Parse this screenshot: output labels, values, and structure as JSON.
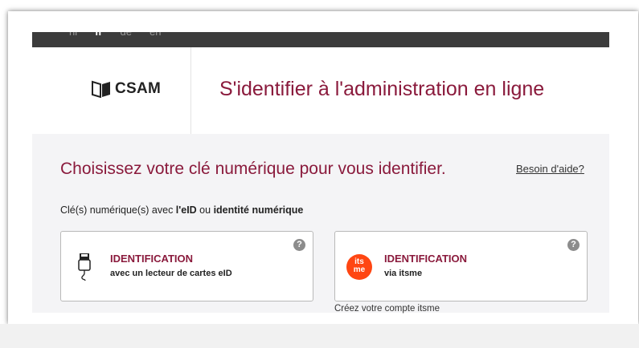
{
  "languages": [
    {
      "label": "nl",
      "active": false
    },
    {
      "label": "fr",
      "active": true
    },
    {
      "label": "de",
      "active": false
    },
    {
      "label": "en",
      "active": false
    }
  ],
  "header": {
    "logo_text": "CSAM",
    "title": "S'identifier à l'administration en ligne"
  },
  "main": {
    "choose_title": "Choisissez votre clé numérique pour vous identifier.",
    "help_link": "Besoin d'aide?",
    "subtitle": {
      "prefix": "Clé(s) numérique(s) avec ",
      "bold1": "l'eID",
      "middle": " ou ",
      "bold2": "identité numérique"
    },
    "cards": [
      {
        "title": "IDENTIFICATION",
        "subtitle": "avec un lecteur de cartes eID",
        "icon": "card-reader-icon"
      },
      {
        "title": "IDENTIFICATION",
        "subtitle": "via itsme",
        "icon": "itsme-logo-icon",
        "icon_text_line1": "its",
        "icon_text_line2": "me"
      }
    ],
    "create_link": "Créez votre compte itsme"
  },
  "colors": {
    "accent": "#8a1a3c",
    "topbar": "#3c3c3c",
    "itsme": "#ff4612",
    "background": "#f4f4f6"
  }
}
